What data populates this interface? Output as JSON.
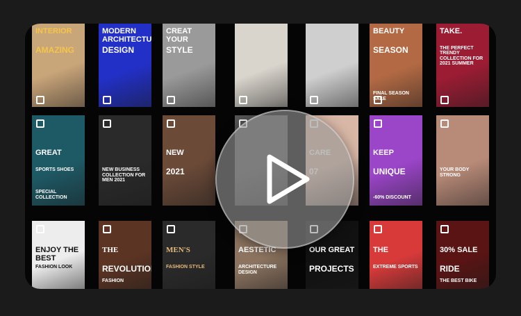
{
  "player": {
    "play_icon": "play-icon",
    "tiles": [
      {
        "l1": "INTERIOR",
        "l2": "AMAZING",
        "sub": "",
        "bg": "#c9a57a",
        "fg": "#f3c64a"
      },
      {
        "l1": "MODERN ARCHITECTURE",
        "l2": "DESIGN",
        "sub": "",
        "bg": "#2230c8",
        "fg": "#ffffff"
      },
      {
        "l1": "CREAT YOUR",
        "l2": "STYLE",
        "sub": "",
        "bg": "#9a9a9a",
        "fg": "#ffffff"
      },
      {
        "l1": "",
        "l2": "",
        "sub": "",
        "bg": "#d9d4cc",
        "fg": "#222222"
      },
      {
        "l1": "",
        "l2": "",
        "sub": "",
        "bg": "#cfcfcf",
        "fg": "#111111"
      },
      {
        "l1": "BEAUTY",
        "l2": "SEASON",
        "sub": "FINAL SEASON SALE",
        "bg": "#b36a44",
        "fg": "#ffffff"
      },
      {
        "l1": "take.",
        "l2": "THE PERFECT TRENDY COLLECTION FOR 2021 SUMMER",
        "sub": "",
        "bg": "#9c1c34",
        "fg": "#ffffff"
      },
      {
        "l1": "GREAT",
        "l2": "SPORTS SHOES",
        "sub": "SPECIAL COLLECTION",
        "bg": "#1e5a66",
        "fg": "#ffffff"
      },
      {
        "l1": "",
        "l2": "NEW BUSINESS COLLECTION FOR MEN 2021",
        "sub": "",
        "bg": "#2a2a2a",
        "fg": "#ffffff"
      },
      {
        "l1": "NEW",
        "l2": "2021",
        "sub": "",
        "bg": "#6b4a38",
        "fg": "#ffffff"
      },
      {
        "l1": "",
        "l2": "",
        "sub": "",
        "bg": "#555555",
        "fg": "#ffffff"
      },
      {
        "l1": "care",
        "l2": "07",
        "sub": "",
        "bg": "#d8b7a6",
        "fg": "#ffffff"
      },
      {
        "l1": "KEEP",
        "l2": "UNIQUE",
        "sub": "-60% DISCOUNT",
        "bg": "#9b45c8",
        "fg": "#ffffff"
      },
      {
        "l1": "",
        "l2": "YOUR BODY STRONG",
        "sub": "",
        "bg": "#b88a78",
        "fg": "#ffffff"
      },
      {
        "l1": "ENJOY THE BEST",
        "l2": "FASHION LOOK",
        "sub": "",
        "bg": "#ededed",
        "fg": "#111111"
      },
      {
        "l1": "THE",
        "l2": "REVOLUTION",
        "sub": "FASHION",
        "bg": "#5b3423",
        "fg": "#ffffff"
      },
      {
        "l1": "MEN'S",
        "l2": "FASHION STYLE",
        "sub": "",
        "bg": "#2a2a2a",
        "fg": "#e7b97a"
      },
      {
        "l1": "AESTETIC",
        "l2": "ARCHITECTURE DESIGN",
        "sub": "",
        "bg": "#8c7460",
        "fg": "#ffffff"
      },
      {
        "l1": "OUR GREAT",
        "l2": "PROJECTS",
        "sub": "",
        "bg": "#111111",
        "fg": "#ffffff"
      },
      {
        "l1": "THE",
        "l2": "EXTREME SPORTS",
        "sub": "",
        "bg": "#d83a3a",
        "fg": "#ffffff"
      },
      {
        "l1": "30% SALE",
        "l2": "RIDE",
        "sub": "THE BEST BIKE",
        "bg": "#5a1414",
        "fg": "#ffffff"
      }
    ]
  }
}
